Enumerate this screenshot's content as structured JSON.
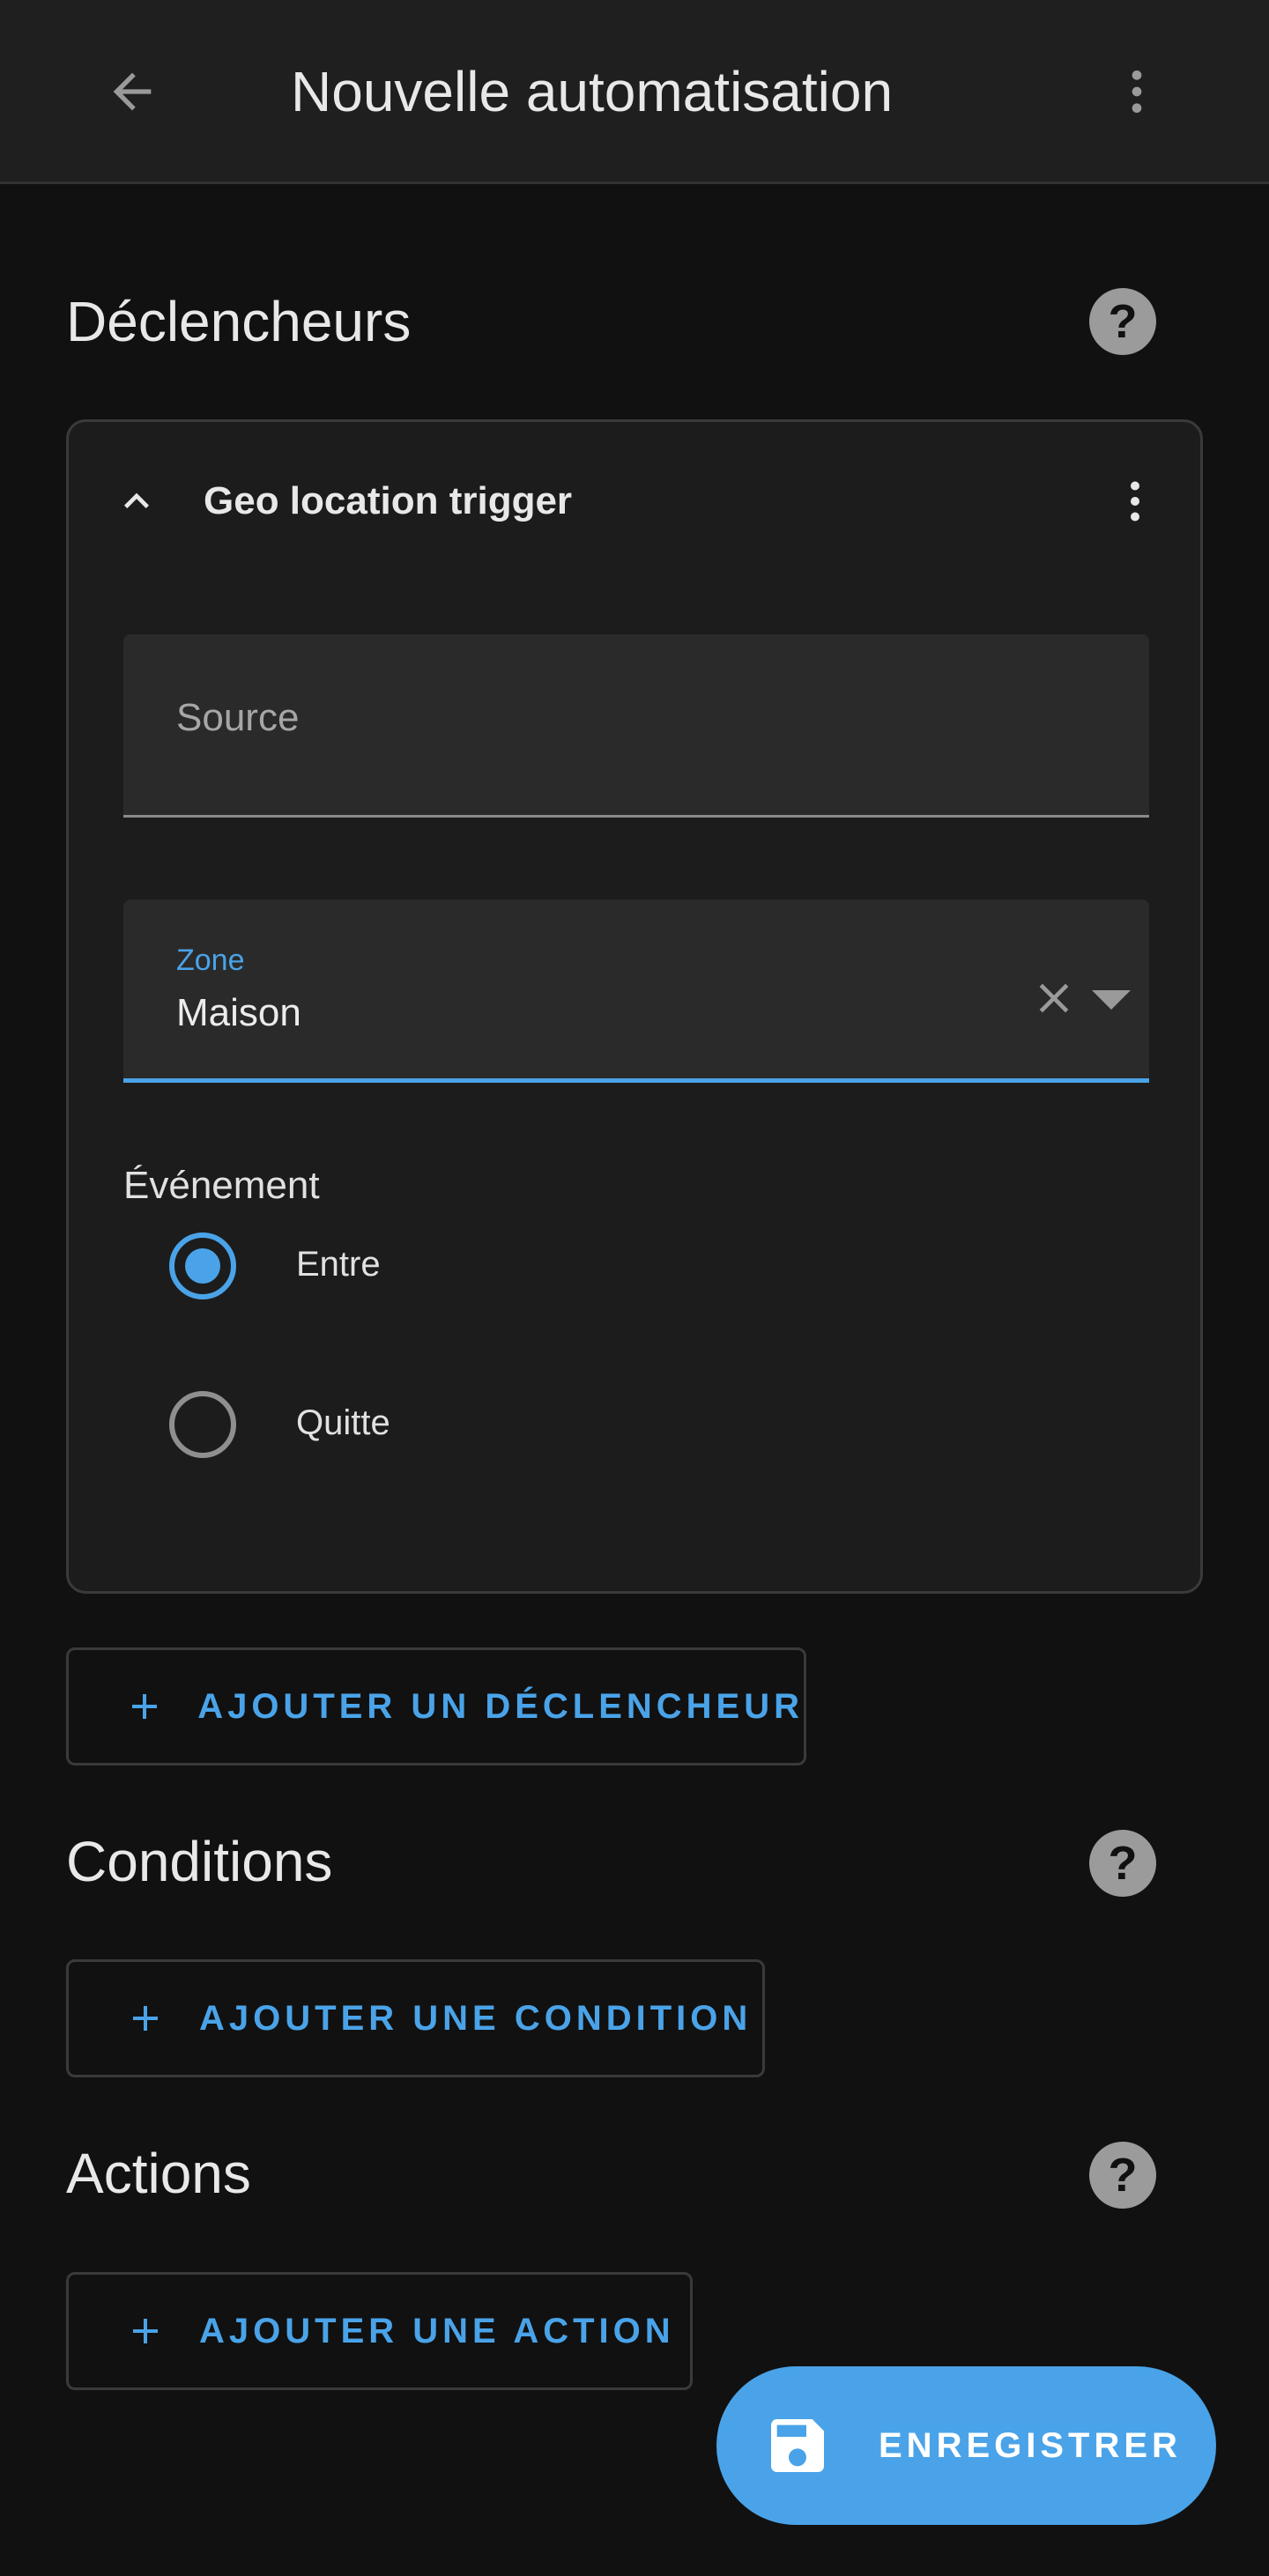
{
  "header": {
    "title": "Nouvelle automatisation",
    "back_icon": "arrow-left-icon",
    "menu_icon": "dots-vertical-icon"
  },
  "triggers": {
    "title": "Déclencheurs",
    "help_icon": "help-circle-icon",
    "card": {
      "label": "Geo location trigger",
      "source": {
        "placeholder": "Source",
        "value": ""
      },
      "zone": {
        "label": "Zone",
        "value": "Maison"
      },
      "event": {
        "label": "Événement",
        "options": [
          {
            "label": "Entre",
            "selected": true
          },
          {
            "label": "Quitte",
            "selected": false
          }
        ]
      }
    },
    "add_label": "AJOUTER UN DÉCLENCHEUR"
  },
  "conditions": {
    "title": "Conditions",
    "add_label": "AJOUTER UNE CONDITION"
  },
  "actions": {
    "title": "Actions",
    "add_label": "AJOUTER UNE ACTION"
  },
  "fab": {
    "label": "ENREGISTRER",
    "icon": "content-save-icon"
  },
  "colors": {
    "accent": "#4aa3e8",
    "background": "#111111",
    "surface": "#1c1c1c",
    "field": "#2a2a2a"
  }
}
